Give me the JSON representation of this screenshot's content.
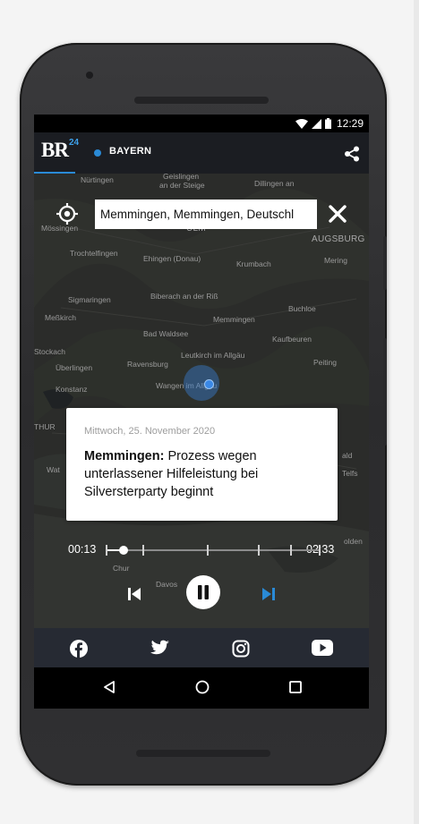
{
  "status_bar": {
    "time": "12:29"
  },
  "app_bar": {
    "logo": "BR",
    "logo_superscript": "24",
    "region": "BAYERN",
    "region_color": "#2a8ad6"
  },
  "search": {
    "value": "Memmingen, Memmingen, Deutschl"
  },
  "map": {
    "labels": [
      "Nürtingen",
      "Geislingen",
      "an der Steige",
      "Dillingen an",
      "Mössingen",
      "ULM",
      "AUGSBURG",
      "Trochtelfingen",
      "Ehingen (Donau)",
      "Krumbach",
      "Mering",
      "Sigmaringen",
      "Biberach an der Riß",
      "Buchloe",
      "Meßkirch",
      "Memmingen",
      "Bad Waldsee",
      "Kaufbeuren",
      "Stockach",
      "Leutkirch im Allgäu",
      "Peiting",
      "Überlingen",
      "Ravensburg",
      "Konstanz",
      "Wangen im Allgäu",
      "THUR",
      "Wat",
      "ald",
      "Telfs",
      "Chur",
      "Davos",
      "olden"
    ]
  },
  "news_card": {
    "date": "Mittwoch, 25. November 2020",
    "title_bold": "Memmingen:",
    "title_rest": " Prozess wegen unterlassener Hilfeleistung bei Silversterparty beginnt"
  },
  "player": {
    "elapsed": "00:13",
    "duration": "02:33",
    "progress_fraction": 0.085,
    "chapter_markers_fraction": [
      0.0,
      0.17,
      0.47,
      0.71,
      0.86
    ],
    "accent": "#2a8ad6"
  },
  "social": {
    "icons": [
      "facebook-icon",
      "twitter-icon",
      "instagram-icon",
      "youtube-icon"
    ]
  },
  "nav": {
    "icons": [
      "back-icon",
      "home-icon",
      "recents-icon"
    ]
  }
}
